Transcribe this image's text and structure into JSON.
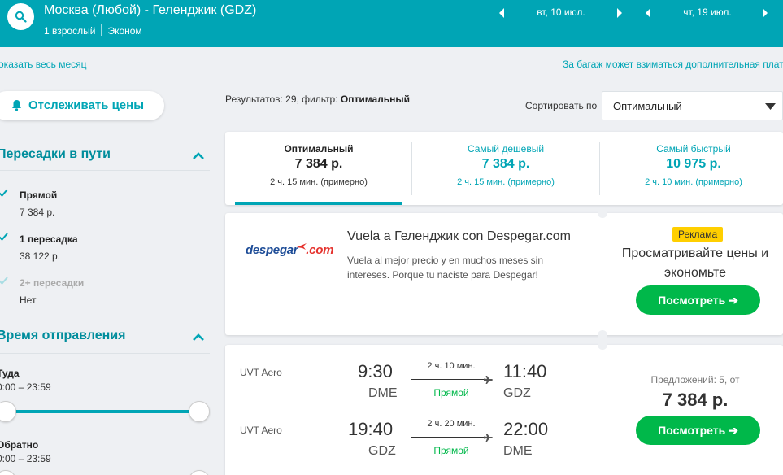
{
  "header": {
    "route": "Москва (Любой) - Геленджик (GDZ)",
    "passengers": "1 взрослый",
    "cabin": "Эконом",
    "depart_date": "вт, 10 июл.",
    "return_date": "чт, 19 июл.",
    "bg_color": "#00a5b5"
  },
  "subheader": {
    "show_month": "оказать весь месяц",
    "baggage_note": "За багаж может взиматься дополнительная плат"
  },
  "filters": {
    "track_prices": "Отслеживать цены",
    "stops": {
      "title": "Пересадки в пути",
      "options": [
        {
          "label": "Прямой",
          "price": "7 384 р.",
          "checked": true
        },
        {
          "label": "1 пересадка",
          "price": "38 122 р.",
          "checked": true
        },
        {
          "label": "2+ пересадки",
          "price": "Нет",
          "checked": true
        }
      ]
    },
    "departure_time": {
      "title": "Время отправления",
      "outbound_label": "Туда",
      "outbound_range": "0:00 – 23:59",
      "return_label": "Обратно",
      "return_range": "0:00 – 23:59"
    }
  },
  "results": {
    "count_text": "Результатов: 29, фильтр: ",
    "filter_name": "Оптимальный",
    "sort_label": "Сортировать по",
    "sort_value": "Оптимальный"
  },
  "tabs": [
    {
      "title": "Оптимальный",
      "price": "7 384 р.",
      "duration": "2 ч. 15 мин. (примерно)",
      "active": true
    },
    {
      "title": "Самый дешевый",
      "price": "7 384 р.",
      "duration": "2 ч. 15 мин. (примерно)",
      "active": false
    },
    {
      "title": "Самый быстрый",
      "price": "10 975 р.",
      "duration": "2 ч. 10 мин. (примерно)",
      "active": false
    }
  ],
  "ad": {
    "logo": "despegar",
    "logo_accent": ".com",
    "title": "Vuela a Геленджик con Despegar.com",
    "description": "Vuela al mejor precio y en muchos meses sin intereses. Porque tu naciste para Despegar!",
    "badge": "Реклама",
    "cta_text": "Просматривайте цены и экономьте",
    "button": "Посмотреть ➔"
  },
  "flight": {
    "offers": "Предложений: 5, от",
    "price": "7 384 р.",
    "button": "Посмотреть ➔",
    "legs": [
      {
        "airline": "UVT Aero",
        "dep_time": "9:30",
        "dep_airport": "DME",
        "duration": "2 ч. 10 мин.",
        "stops": "Прямой",
        "arr_time": "11:40",
        "arr_airport": "GDZ"
      },
      {
        "airline": "UVT Aero",
        "dep_time": "19:40",
        "dep_airport": "GDZ",
        "duration": "2 ч. 20 мин.",
        "stops": "Прямой",
        "arr_time": "22:00",
        "arr_airport": "DME"
      }
    ]
  }
}
